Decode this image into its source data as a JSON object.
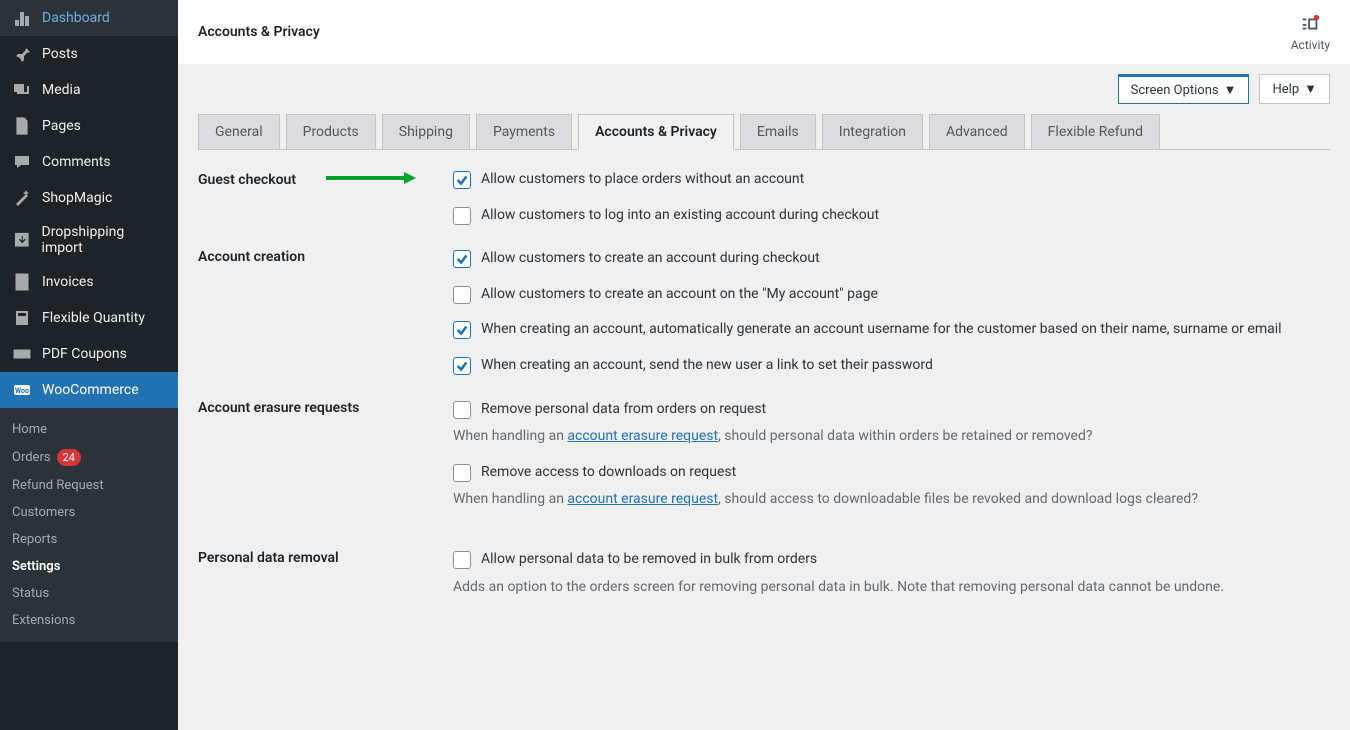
{
  "sidebar": {
    "items": [
      {
        "label": "Dashboard",
        "icon": "dashboard"
      },
      {
        "label": "Posts",
        "icon": "pin"
      },
      {
        "label": "Media",
        "icon": "media"
      },
      {
        "label": "Pages",
        "icon": "pages"
      },
      {
        "label": "Comments",
        "icon": "comments"
      },
      {
        "label": "ShopMagic",
        "icon": "magic"
      },
      {
        "label": "Dropshipping import",
        "icon": "download"
      },
      {
        "label": "Invoices",
        "icon": "invoice"
      },
      {
        "label": "Flexible Quantity",
        "icon": "calc"
      },
      {
        "label": "PDF Coupons",
        "icon": "coupon"
      },
      {
        "label": "WooCommerce",
        "icon": "woo"
      }
    ],
    "submenu": [
      {
        "label": "Home"
      },
      {
        "label": "Orders",
        "badge": "24"
      },
      {
        "label": "Refund Request"
      },
      {
        "label": "Customers"
      },
      {
        "label": "Reports"
      },
      {
        "label": "Settings"
      },
      {
        "label": "Status"
      },
      {
        "label": "Extensions"
      }
    ]
  },
  "topbar": {
    "title": "Accounts & Privacy",
    "activity_label": "Activity"
  },
  "topactions": {
    "screen_options": "Screen Options",
    "help": "Help"
  },
  "tabs": [
    {
      "label": "General"
    },
    {
      "label": "Products"
    },
    {
      "label": "Shipping"
    },
    {
      "label": "Payments"
    },
    {
      "label": "Accounts & Privacy"
    },
    {
      "label": "Emails"
    },
    {
      "label": "Integration"
    },
    {
      "label": "Advanced"
    },
    {
      "label": "Flexible Refund"
    }
  ],
  "sections": {
    "guest_checkout": {
      "title": "Guest checkout",
      "opt1": "Allow customers to place orders without an account",
      "opt2": "Allow customers to log into an existing account during checkout"
    },
    "account_creation": {
      "title": "Account creation",
      "opt1": "Allow customers to create an account during checkout",
      "opt2": "Allow customers to create an account on the \"My account\" page",
      "opt3": "When creating an account, automatically generate an account username for the customer based on their name, surname or email",
      "opt4": "When creating an account, send the new user a link to set their password"
    },
    "erasure": {
      "title": "Account erasure requests",
      "opt1": "Remove personal data from orders on request",
      "help1_prefix": "When handling an ",
      "help1_link": "account erasure request",
      "help1_suffix": ", should personal data within orders be retained or removed?",
      "opt2": "Remove access to downloads on request",
      "help2_prefix": "When handling an ",
      "help2_link": "account erasure request",
      "help2_suffix": ", should access to downloadable files be revoked and download logs cleared?"
    },
    "removal": {
      "title": "Personal data removal",
      "opt1": "Allow personal data to be removed in bulk from orders",
      "help1": "Adds an option to the orders screen for removing personal data in bulk. Note that removing personal data cannot be undone."
    }
  }
}
